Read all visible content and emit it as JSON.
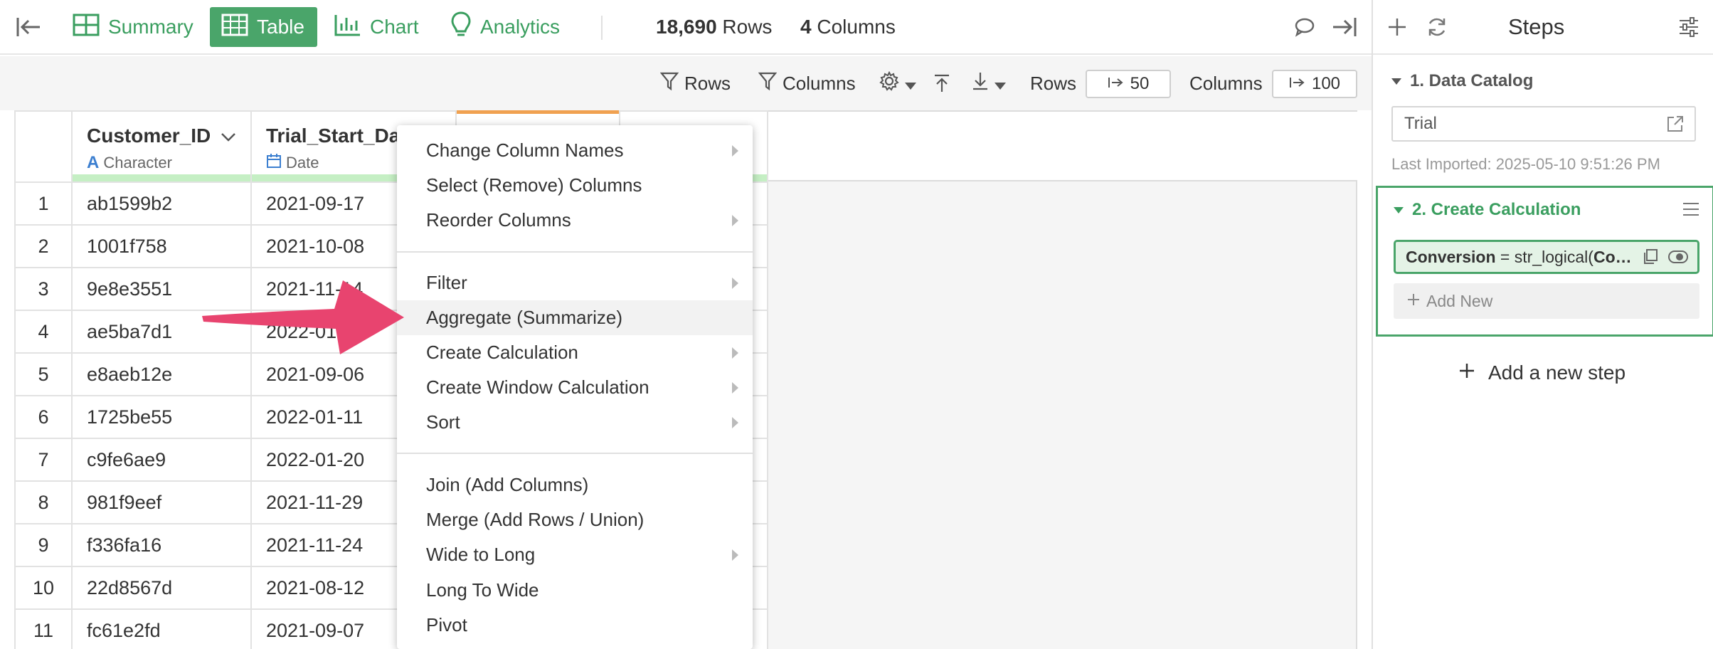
{
  "topbar": {
    "tabs": [
      {
        "label": "Summary",
        "icon": "summary-grid-icon"
      },
      {
        "label": "Table",
        "icon": "table-icon",
        "active": true
      },
      {
        "label": "Chart",
        "icon": "bar-chart-icon"
      },
      {
        "label": "Analytics",
        "icon": "lightbulb-icon"
      }
    ],
    "rows_count": "18,690",
    "rows_label": "Rows",
    "columns_count": "4",
    "columns_label": "Columns"
  },
  "toolbar": {
    "rows_filter_label": "Rows",
    "columns_filter_label": "Columns",
    "rows_display_label": "Rows",
    "rows_display_value": "50",
    "columns_display_label": "Columns",
    "columns_display_value": "100"
  },
  "table": {
    "columns": [
      {
        "name": "Customer_ID",
        "type": "Character"
      },
      {
        "name": "Trial_Start_Da",
        "type": "Date"
      }
    ],
    "rows": [
      {
        "num": "1",
        "customer_id": "ab1599b2",
        "trial_start": "2021-09-17"
      },
      {
        "num": "2",
        "customer_id": "1001f758",
        "trial_start": "2021-10-08"
      },
      {
        "num": "3",
        "customer_id": "9e8e3551",
        "trial_start": "2021-11-14"
      },
      {
        "num": "4",
        "customer_id": "ae5ba7d1",
        "trial_start": "2022-01"
      },
      {
        "num": "5",
        "customer_id": "e8aeb12e",
        "trial_start": "2021-09-06"
      },
      {
        "num": "6",
        "customer_id": "1725be55",
        "trial_start": "2022-01-11"
      },
      {
        "num": "7",
        "customer_id": "c9fe6ae9",
        "trial_start": "2022-01-20"
      },
      {
        "num": "8",
        "customer_id": "981f9eef",
        "trial_start": "2021-11-29"
      },
      {
        "num": "9",
        "customer_id": "f336fa16",
        "trial_start": "2021-11-24"
      },
      {
        "num": "10",
        "customer_id": "22d8567d",
        "trial_start": "2021-08-12"
      },
      {
        "num": "11",
        "customer_id": "fc61e2fd",
        "trial_start": "2021-09-07"
      }
    ]
  },
  "menu": {
    "items": [
      {
        "label": "Change Column Names"
      },
      {
        "label": "Select (Remove) Columns"
      },
      {
        "label": "Reorder Columns"
      },
      {
        "label": "Filter"
      },
      {
        "label": "Aggregate (Summarize)"
      },
      {
        "label": "Create Calculation"
      },
      {
        "label": "Create Window Calculation"
      },
      {
        "label": "Sort"
      },
      {
        "label": "Join (Add Columns)"
      },
      {
        "label": "Merge (Add Rows / Union)"
      },
      {
        "label": "Wide to Long"
      },
      {
        "label": "Long To Wide"
      },
      {
        "label": "Pivot"
      }
    ]
  },
  "steps_panel": {
    "title": "Steps",
    "step1": {
      "title": "1. Data Catalog",
      "source": "Trial",
      "last_imported": "Last Imported: 2025-05-10 9:51:26 PM"
    },
    "step2": {
      "title": "2. Create Calculation",
      "calc_name": "Conversion",
      "calc_expr": " = str_logical(",
      "calc_arg": "Co…",
      "add_new": "Add New"
    },
    "add_step": "Add a new step"
  },
  "colors": {
    "accent_green": "#4aa56a",
    "arrow_pink": "#e8446f",
    "header_green_bar": "#c5efc4",
    "selected_column_orange": "#f0a150"
  }
}
